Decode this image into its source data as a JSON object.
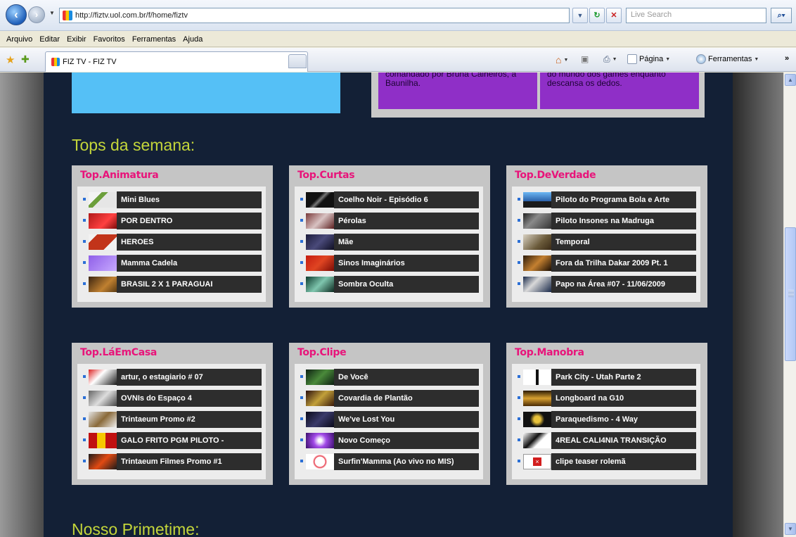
{
  "browser": {
    "url": "http://fiztv.uol.com.br/f/home/fiztv",
    "search_placeholder": "Live Search",
    "tab_title": "FIZ TV - FIZ TV",
    "menu": [
      "Arquivo",
      "Editar",
      "Exibir",
      "Favoritos",
      "Ferramentas",
      "Ajuda"
    ],
    "commands": {
      "page": "Página",
      "tools": "Ferramentas"
    }
  },
  "featured": {
    "left_text": "comandado por Bruna Calheiros, a Baunilha.",
    "right_text": "do mundo dos games enquanto descansa os dedos."
  },
  "sections": {
    "tops_title": "Tops da semana:",
    "primetime_title": "Nosso Primetime:"
  },
  "tops": [
    {
      "title": "Top.Animatura",
      "items": [
        "Mini Blues",
        "POR DENTRO",
        "HEROES",
        "Mamma Cadela",
        "BRASIL 2 X 1 PARAGUAI"
      ]
    },
    {
      "title": "Top.Curtas",
      "items": [
        "Coelho Noir - Episódio 6",
        "Pérolas",
        "Mãe",
        "Sinos Imaginários",
        "Sombra Oculta"
      ]
    },
    {
      "title": "Top.DeVerdade",
      "items": [
        "Piloto do Programa Bola e Arte",
        "Piloto Insones na Madruga",
        "Temporal",
        "Fora da Trilha Dakar 2009 Pt. 1",
        "Papo na Área #07 - 11/06/2009"
      ]
    },
    {
      "title": "Top.LáEmCasa",
      "items": [
        "artur, o estagiario # 07",
        "OVNIs do Espaço 4",
        "Trintaeum Promo #2",
        "GALO FRITO PGM PILOTO -",
        "Trintaeum Filmes Promo #1"
      ]
    },
    {
      "title": "Top.Clipe",
      "items": [
        "De Você",
        "Covardia de Plantão",
        "We've Lost You",
        "Novo Começo",
        "Surfin'Mamma (Ao vivo no MIS)"
      ]
    },
    {
      "title": "Top.Manobra",
      "items": [
        "Park City - Utah Parte 2",
        "Longboard na G10",
        "Paraquedismo - 4 Way",
        "4REAL CALI4NIA TRANSIÇÃO",
        "clipe teaser rolemã"
      ]
    }
  ],
  "colors": {
    "page_bg": "#132036",
    "section_title": "#c4d63a",
    "box_title": "#e8147a",
    "item_bar": "#2d2d2d",
    "featured_blue": "#55c0f6",
    "featured_purple": "#8f2fc7"
  }
}
